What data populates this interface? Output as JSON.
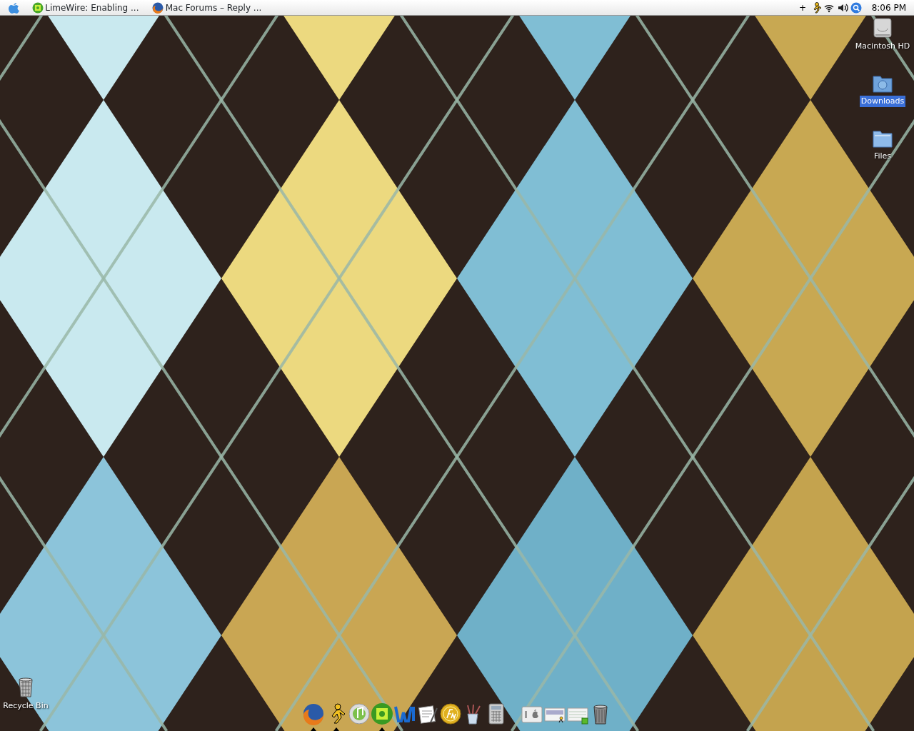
{
  "menu_bar": {
    "tasks": [
      {
        "kind": "lime-ball",
        "label": "LimeWire: Enabling ..."
      },
      {
        "kind": "globe",
        "label": "Mac Forums – Reply ..."
      }
    ],
    "tray": {
      "plus": "+",
      "icons": [
        {
          "kind": "runner"
        },
        {
          "kind": "wifi"
        },
        {
          "kind": "speaker"
        },
        {
          "kind": "search"
        }
      ],
      "clock": "8:06 PM"
    }
  },
  "desktop_icons": [
    {
      "kind": "disk",
      "label": "Macintosh HD",
      "selected": false
    },
    {
      "kind": "download-folder",
      "label": "Downloads",
      "selected": true
    },
    {
      "kind": "folder",
      "label": "Files",
      "selected": false
    },
    {
      "kind": "bin",
      "label": "Recycle Bin",
      "selected": false
    }
  ],
  "dock": {
    "apps": [
      {
        "kind": "globe",
        "running": true
      },
      {
        "kind": "runner",
        "running": true
      },
      {
        "kind": "disc",
        "running": false
      },
      {
        "kind": "lime-ball",
        "running": true
      },
      {
        "kind": "wave",
        "running": false
      },
      {
        "kind": "document",
        "running": false
      },
      {
        "kind": "coin",
        "running": false
      },
      {
        "kind": "brushes",
        "running": false
      },
      {
        "kind": "calculator",
        "running": false
      }
    ],
    "windows": [
      {
        "kind": "panel"
      },
      {
        "kind": "window-runner"
      },
      {
        "kind": "window-lime"
      },
      {
        "kind": "trash"
      }
    ]
  }
}
